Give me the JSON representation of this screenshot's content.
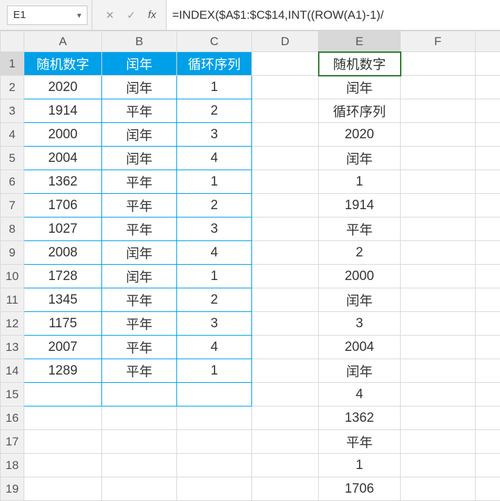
{
  "namebox": {
    "value": "E1",
    "dropdown_glyph": "▾"
  },
  "fx_buttons": {
    "cancel": "✕",
    "confirm": "✓",
    "fx": "fx"
  },
  "formula": "=INDEX($A$1:$C$14,INT((ROW(A1)-1)/",
  "col_headers": [
    "A",
    "B",
    "C",
    "D",
    "E",
    "F"
  ],
  "row_headers": [
    "1",
    "2",
    "3",
    "4",
    "5",
    "6",
    "7",
    "8",
    "9",
    "10",
    "11",
    "12",
    "13",
    "14",
    "15",
    "16",
    "17",
    "18",
    "19"
  ],
  "selected_cell": "E1",
  "table_abc": {
    "headers": [
      "随机数字",
      "闰年",
      "循环序列"
    ],
    "rows": [
      [
        "2020",
        "闰年",
        "1"
      ],
      [
        "1914",
        "平年",
        "2"
      ],
      [
        "2000",
        "闰年",
        "3"
      ],
      [
        "2004",
        "闰年",
        "4"
      ],
      [
        "1362",
        "平年",
        "1"
      ],
      [
        "1706",
        "平年",
        "2"
      ],
      [
        "1027",
        "平年",
        "3"
      ],
      [
        "2008",
        "闰年",
        "4"
      ],
      [
        "1728",
        "闰年",
        "1"
      ],
      [
        "1345",
        "平年",
        "2"
      ],
      [
        "1175",
        "平年",
        "3"
      ],
      [
        "2007",
        "平年",
        "4"
      ],
      [
        "1289",
        "平年",
        "1"
      ]
    ]
  },
  "col_e": [
    "随机数字",
    "闰年",
    "循环序列",
    "2020",
    "闰年",
    "1",
    "1914",
    "平年",
    "2",
    "2000",
    "闰年",
    "3",
    "2004",
    "闰年",
    "4",
    "1362",
    "平年",
    "1",
    "1706"
  ]
}
